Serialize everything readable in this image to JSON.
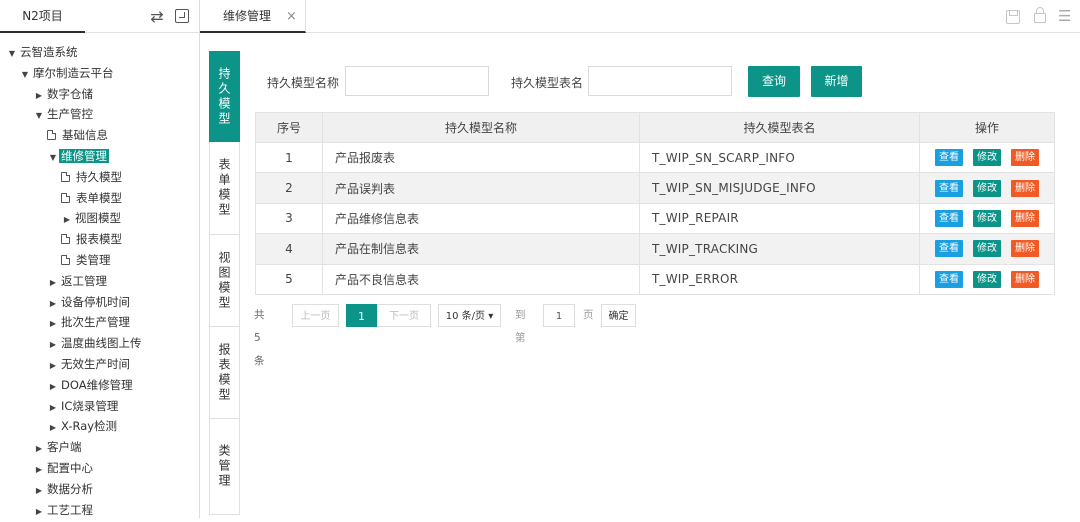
{
  "sidebar": {
    "project_tab": "N2项目",
    "tree": [
      {
        "label": "云智造系统",
        "type": "arrow-down",
        "level": 0
      },
      {
        "label": "摩尔制造云平台",
        "type": "arrow-down",
        "level": 1
      },
      {
        "label": "数字仓储",
        "type": "arrow-right",
        "level": 2
      },
      {
        "label": "生产管控",
        "type": "arrow-down",
        "level": 2
      },
      {
        "label": "基础信息",
        "type": "doc",
        "level": 3
      },
      {
        "label": "维修管理",
        "type": "arrow-down",
        "level": 3,
        "selected": true
      },
      {
        "label": "持久模型",
        "type": "doc",
        "level": 4
      },
      {
        "label": "表单模型",
        "type": "doc",
        "level": 4
      },
      {
        "label": "视图模型",
        "type": "arrow-right",
        "level": 4
      },
      {
        "label": "报表模型",
        "type": "doc",
        "level": 4
      },
      {
        "label": "类管理",
        "type": "doc",
        "level": 4
      },
      {
        "label": "返工管理",
        "type": "arrow-right",
        "level": 3
      },
      {
        "label": "设备停机时间",
        "type": "arrow-right",
        "level": 3
      },
      {
        "label": "批次生产管理",
        "type": "arrow-right",
        "level": 3
      },
      {
        "label": "温度曲线图上传",
        "type": "arrow-right",
        "level": 3
      },
      {
        "label": "无效生产时间",
        "type": "arrow-right",
        "level": 3
      },
      {
        "label": "DOA维修管理",
        "type": "arrow-right",
        "level": 3
      },
      {
        "label": "IC烧录管理",
        "type": "arrow-right",
        "level": 3
      },
      {
        "label": "X-Ray检测",
        "type": "arrow-right",
        "level": 3
      },
      {
        "label": "客户端",
        "type": "arrow-right",
        "level": 2
      },
      {
        "label": "配置中心",
        "type": "arrow-right",
        "level": 2
      },
      {
        "label": "数据分析",
        "type": "arrow-right",
        "level": 2
      },
      {
        "label": "工艺工程",
        "type": "arrow-right",
        "level": 2
      }
    ]
  },
  "topbar": {
    "active_tab": "维修管理",
    "close_glyph": "×",
    "menu_glyph": "☰"
  },
  "vtabs": [
    {
      "label": "持久模型",
      "active": true
    },
    {
      "label": "表单模型",
      "active": false
    },
    {
      "label": "视图模型",
      "active": false
    },
    {
      "label": "报表模型",
      "active": false
    },
    {
      "label": "类管理",
      "active": false
    }
  ],
  "search": {
    "name_label": "持久模型名称",
    "name_value": "",
    "table_label": "持久模型表名",
    "table_value": "",
    "query_button": "查询",
    "add_button": "新增"
  },
  "table": {
    "headers": [
      "序号",
      "持久模型名称",
      "持久模型表名",
      "操作"
    ],
    "ops": {
      "view": "查看",
      "edit": "修改",
      "delete": "删除"
    },
    "rows": [
      {
        "num": "1",
        "name": "产品报废表",
        "table": "T_WIP_SN_SCARP_INFO"
      },
      {
        "num": "2",
        "name": "产品误判表",
        "table": "T_WIP_SN_MISJUDGE_INFO"
      },
      {
        "num": "3",
        "name": "产品维修信息表",
        "table": "T_WIP_REPAIR"
      },
      {
        "num": "4",
        "name": "产品在制信息表",
        "table": "T_WIP_TRACKING"
      },
      {
        "num": "5",
        "name": "产品不良信息表",
        "table": "T_WIP_ERROR"
      }
    ]
  },
  "pager": {
    "total": "共 5 条",
    "prev": "上一页",
    "current": "1",
    "next": "下一页",
    "page_size": "10 条/页 ▾",
    "goto_label": "到第",
    "goto_value": "1",
    "page_unit": "页",
    "confirm": "确定"
  },
  "colors": {
    "accent": "#0d9488",
    "view": "#1aa0e0",
    "delete": "#f15a24"
  }
}
